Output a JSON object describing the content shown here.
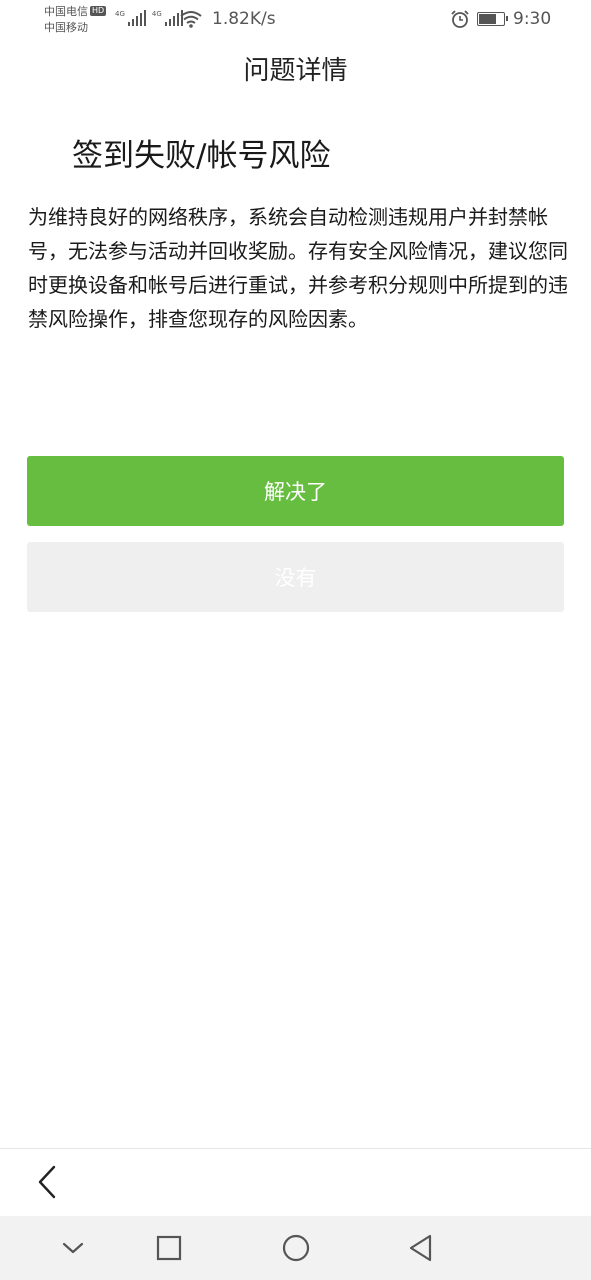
{
  "status_bar": {
    "carrier_1": "中国电信",
    "hd_badge": "HD",
    "carrier_2": "中国移动",
    "network_1": "4G",
    "network_2": "4G",
    "speed": "1.82K/s",
    "time": "9:30",
    "battery_level": 0.75
  },
  "page_title": "问题详情",
  "heading": "签到失败/帐号风险",
  "description": "为维持良好的网络秩序，系统会自动检测违规用户并封禁帐号，无法参与活动并回收奖励。存有安全风险情况，建议您同时更换设备和帐号后进行重试，并参考积分规则中所提到的违禁风险操作，排查您现存的风险因素。",
  "buttons": {
    "resolved": "解决了",
    "not_resolved": "没有"
  },
  "colors": {
    "primary_button": "#66bd3f",
    "secondary_button": "#efefef",
    "nav_bar": "#f2f2f2"
  },
  "icons": {
    "back": "chevron-left-icon",
    "nav_down": "chevron-down-icon",
    "nav_recent": "square-icon",
    "nav_home": "circle-icon",
    "nav_back": "triangle-back-icon"
  }
}
